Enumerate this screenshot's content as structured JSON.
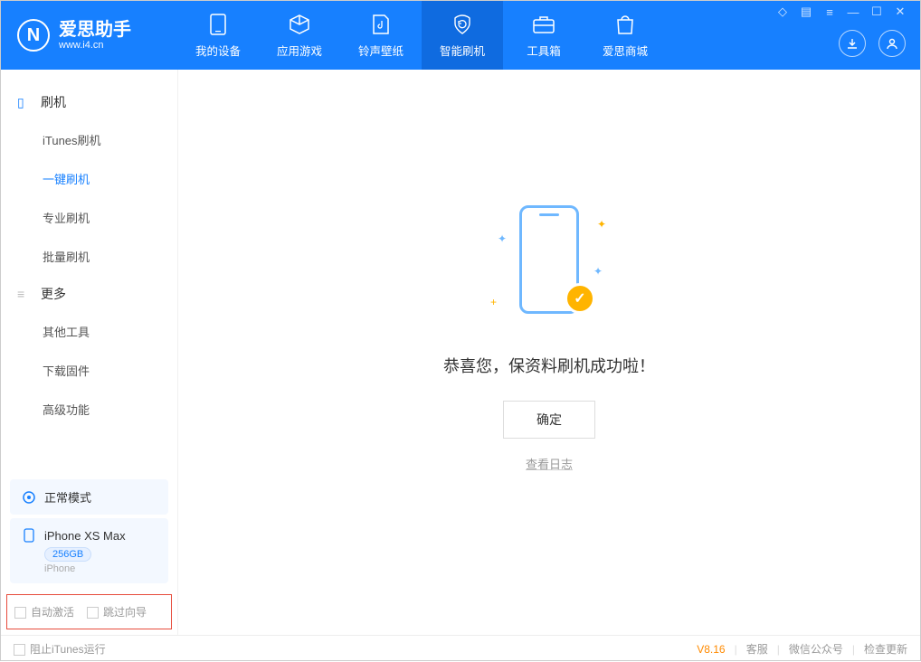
{
  "app": {
    "title": "爱思助手",
    "subtitle": "www.i4.cn"
  },
  "nav": {
    "tabs": [
      {
        "label": "我的设备"
      },
      {
        "label": "应用游戏"
      },
      {
        "label": "铃声壁纸"
      },
      {
        "label": "智能刷机"
      },
      {
        "label": "工具箱"
      },
      {
        "label": "爱思商城"
      }
    ],
    "active_index": 3
  },
  "sidebar": {
    "group1": {
      "title": "刷机",
      "items": [
        "iTunes刷机",
        "一键刷机",
        "专业刷机",
        "批量刷机"
      ],
      "active_index": 1
    },
    "group2": {
      "title": "更多",
      "items": [
        "其他工具",
        "下载固件",
        "高级功能"
      ]
    },
    "mode_card": {
      "label": "正常模式"
    },
    "device_card": {
      "name": "iPhone XS Max",
      "storage": "256GB",
      "type": "iPhone"
    },
    "options": {
      "auto_activate": "自动激活",
      "skip_guide": "跳过向导"
    }
  },
  "main": {
    "success_message": "恭喜您，保资料刷机成功啦！",
    "ok_button": "确定",
    "log_link": "查看日志"
  },
  "footer": {
    "block_itunes": "阻止iTunes运行",
    "version": "V8.16",
    "links": [
      "客服",
      "微信公众号",
      "检查更新"
    ]
  }
}
